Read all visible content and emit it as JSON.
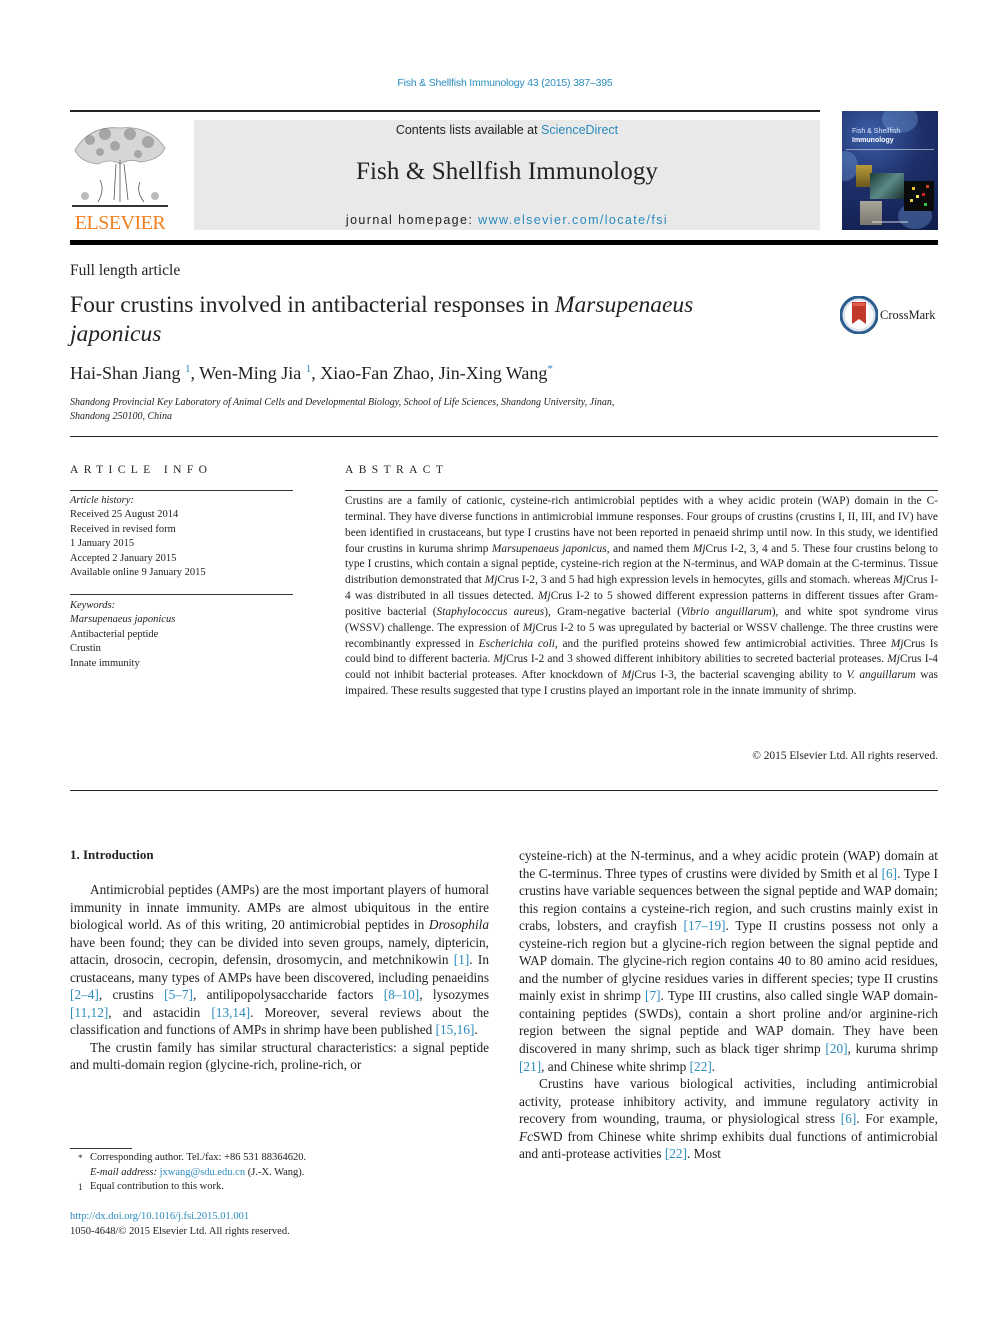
{
  "header": {
    "citation": "Fish & Shellfish Immunology 43 (2015) 387–395",
    "publisher_logo_text": "ELSEVIER",
    "contents_prefix": "Contents lists available at ",
    "contents_link": "ScienceDirect",
    "journal_name": "Fish & Shellfish Immunology",
    "homepage_prefix": "journal homepage: ",
    "homepage_link": "www.elsevier.com/locate/fsi",
    "cover_title_line1": "Fish & Shellfish",
    "cover_title_line2": "Immunology"
  },
  "article": {
    "type": "Full length article",
    "title_plain": "Four crustins involved in antibacterial responses in ",
    "title_italic_1": "Marsupenaeus",
    "title_italic_2": "japonicus",
    "crossmark_label": "CrossMark",
    "authors": [
      {
        "name": "Hai-Shan Jiang",
        "mark": "1"
      },
      {
        "name": "Wen-Ming Jia",
        "mark": "1"
      },
      {
        "name": "Xiao-Fan Zhao",
        "mark": ""
      },
      {
        "name": "Jin-Xing Wang",
        "mark": "*"
      }
    ],
    "affiliation_line1": "Shandong Provincial Key Laboratory of Animal Cells and Developmental Biology, School of Life Sciences, Shandong University, Jinan,",
    "affiliation_line2": "Shandong 250100, China"
  },
  "article_info": {
    "heading": "ARTICLE INFO",
    "history_label": "Article history:",
    "history": [
      "Received 25 August 2014",
      "Received in revised form",
      "1 January 2015",
      "Accepted 2 January 2015",
      "Available online 9 January 2015"
    ],
    "keywords_label": "Keywords:",
    "keywords": [
      "Marsupenaeus japonicus",
      "Antibacterial peptide",
      "Crustin",
      "Innate immunity"
    ]
  },
  "abstract": {
    "heading": "ABSTRACT",
    "segments": [
      {
        "t": "Crustins are a family of cationic, cysteine-rich antimicrobial peptides with a whey acidic protein (WAP) domain in the C-terminal. They have diverse functions in antimicrobial immune responses. Four groups of crustins (crustins I, II, III, and IV) have been identified in crustaceans, but type I crustins have not been reported in penaeid shrimp until now. In this study, we identified four crustins in kuruma shrimp ",
        "i": false
      },
      {
        "t": "Marsupenaeus japonicus",
        "i": true
      },
      {
        "t": ", and named them ",
        "i": false
      },
      {
        "t": "Mj",
        "i": true
      },
      {
        "t": "Crus I-2, 3, 4 and 5. These four crustins belong to type I crustins, which contain a signal peptide, cysteine-rich region at the N-terminus, and WAP domain at the C-terminus. Tissue distribution demonstrated that ",
        "i": false
      },
      {
        "t": "Mj",
        "i": true
      },
      {
        "t": "Crus I-2, 3 and 5 had high expression levels in hemocytes, gills and stomach. whereas ",
        "i": false
      },
      {
        "t": "Mj",
        "i": true
      },
      {
        "t": "Crus I-4 was distributed in all tissues detected. ",
        "i": false
      },
      {
        "t": "Mj",
        "i": true
      },
      {
        "t": "Crus I-2 to 5 showed different expression patterns in different tissues after Gram-positive bacterial (",
        "i": false
      },
      {
        "t": "Staphylococcus aureus",
        "i": true
      },
      {
        "t": "), Gram-negative bacterial (",
        "i": false
      },
      {
        "t": "Vibrio anguillarum",
        "i": true
      },
      {
        "t": "), and white spot syndrome virus (WSSV) challenge. The expression of ",
        "i": false
      },
      {
        "t": "Mj",
        "i": true
      },
      {
        "t": "Crus I-2 to 5 was upregulated by bacterial or WSSV challenge. The three crustins were recombinantly expressed in ",
        "i": false
      },
      {
        "t": "Escherichia coli",
        "i": true
      },
      {
        "t": ", and the purified proteins showed few antimicrobial activities. Three ",
        "i": false
      },
      {
        "t": "Mj",
        "i": true
      },
      {
        "t": "Crus Is could bind to different bacteria. ",
        "i": false
      },
      {
        "t": "Mj",
        "i": true
      },
      {
        "t": "Crus I-2 and 3 showed different inhibitory abilities to secreted bacterial proteases. ",
        "i": false
      },
      {
        "t": "Mj",
        "i": true
      },
      {
        "t": "Crus I-4 could not inhibit bacterial proteases. After knockdown of ",
        "i": false
      },
      {
        "t": "Mj",
        "i": true
      },
      {
        "t": "Crus I-3, the bacterial scavenging ability to ",
        "i": false
      },
      {
        "t": "V. anguillarum",
        "i": true
      },
      {
        "t": " was impaired. These results suggested that type I crustins played an important role in the innate immunity of shrimp.",
        "i": false
      }
    ],
    "copyright": "© 2015 Elsevier Ltd. All rights reserved."
  },
  "body": {
    "section_heading": "1.  Introduction",
    "left_paragraphs": [
      [
        {
          "t": "Antimicrobial peptides (AMPs) are the most important players of humoral immunity in innate immunity. AMPs are almost ubiquitous in the entire biological world. As of this writing, 20 antimicrobial peptides in ",
          "k": "text"
        },
        {
          "t": "Drosophila",
          "k": "italic"
        },
        {
          "t": " have been found; they can be divided into seven groups, namely, diptericin, attacin, drosocin, cecropin, defensin, drosomycin, and metchnikowin ",
          "k": "text"
        },
        {
          "t": "[1]",
          "k": "ref"
        },
        {
          "t": ". In crustaceans, many types of AMPs have been discovered, including penaeidins ",
          "k": "text"
        },
        {
          "t": "[2–4]",
          "k": "ref"
        },
        {
          "t": ", crustins ",
          "k": "text"
        },
        {
          "t": "[5–7]",
          "k": "ref"
        },
        {
          "t": ", antilipopolysaccharide factors ",
          "k": "text"
        },
        {
          "t": "[8–10]",
          "k": "ref"
        },
        {
          "t": ", lysozymes ",
          "k": "text"
        },
        {
          "t": "[11,12]",
          "k": "ref"
        },
        {
          "t": ", and astacidin ",
          "k": "text"
        },
        {
          "t": "[13,14]",
          "k": "ref"
        },
        {
          "t": ". Moreover, several reviews about the classification and functions of AMPs in shrimp have been published ",
          "k": "text"
        },
        {
          "t": "[15,16]",
          "k": "ref"
        },
        {
          "t": ".",
          "k": "text"
        }
      ],
      [
        {
          "t": "The crustin family has similar structural characteristics: a signal peptide and multi-domain region (glycine-rich, proline-rich, or",
          "k": "text"
        }
      ]
    ],
    "right_paragraphs": [
      [
        {
          "t": "cysteine-rich) at the N-terminus, and a whey acidic protein (WAP) domain at the C-terminus. Three types of crustins were divided by Smith et al ",
          "k": "text"
        },
        {
          "t": "[6]",
          "k": "ref"
        },
        {
          "t": ". Type I crustins have variable sequences between the signal peptide and WAP domain; this region contains a cysteine-rich region, and such crustins mainly exist in crabs, lobsters, and crayfish ",
          "k": "text"
        },
        {
          "t": "[17–19]",
          "k": "ref"
        },
        {
          "t": ". Type II crustins possess not only a cysteine-rich region but a glycine-rich region between the signal peptide and WAP domain. The glycine-rich region contains 40 to 80 amino acid residues, and the number of glycine residues varies in different species; type II crustins mainly exist in shrimp ",
          "k": "text"
        },
        {
          "t": "[7]",
          "k": "ref"
        },
        {
          "t": ". Type III crustins, also called single WAP domain-containing peptides (SWDs), contain a short proline and/or arginine-rich region between the signal peptide and WAP domain. They have been discovered in many shrimp, such as black tiger shrimp ",
          "k": "text"
        },
        {
          "t": "[20]",
          "k": "ref"
        },
        {
          "t": ", kuruma shrimp ",
          "k": "text"
        },
        {
          "t": "[21]",
          "k": "ref"
        },
        {
          "t": ", and Chinese white shrimp ",
          "k": "text"
        },
        {
          "t": "[22]",
          "k": "ref"
        },
        {
          "t": ".",
          "k": "text"
        }
      ],
      [
        {
          "t": "Crustins have various biological activities, including antimicrobial activity, protease inhibitory activity, and immune regulatory activity in recovery from wounding, trauma, or physiological stress ",
          "k": "text"
        },
        {
          "t": "[6]",
          "k": "ref"
        },
        {
          "t": ". For example, ",
          "k": "text"
        },
        {
          "t": "Fc",
          "k": "italic"
        },
        {
          "t": "SWD from Chinese white shrimp exhibits dual functions of antimicrobial and anti-protease activities ",
          "k": "text"
        },
        {
          "t": "[22]",
          "k": "ref"
        },
        {
          "t": ". Most",
          "k": "text"
        }
      ]
    ]
  },
  "footnotes": {
    "corresponding_mark": "*",
    "corresponding": "Corresponding author. Tel./fax: +86 531 88364620.",
    "email_label": "E-mail address: ",
    "email": "jxwang@sdu.edu.cn",
    "email_suffix": " (J.-X. Wang).",
    "equal_mark": "1",
    "equal": "Equal contribution to this work.",
    "doi": "http://dx.doi.org/10.1016/j.fsi.2015.01.001",
    "issn": "1050-4648/© 2015 Elsevier Ltd. All rights reserved."
  },
  "colors": {
    "link": "#2a8bbd",
    "elsevier_orange": "#f07f1e",
    "masthead_bg": "#e9e9e9",
    "crossmark_red": "#c0392b"
  }
}
